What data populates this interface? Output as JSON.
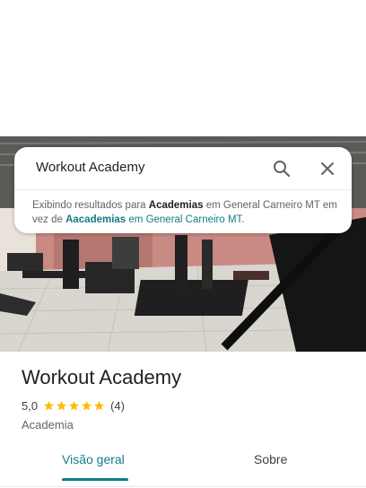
{
  "search": {
    "query": "Workout Academy",
    "notice_prefix": "Exibindo resultados para ",
    "notice_bold": "Academias",
    "notice_location": " em General Carneiro MT",
    "notice_middle": " em vez de ",
    "notice_alt_bold": "Aacademias",
    "notice_alt_location": " em General Carneiro MT",
    "notice_end": "."
  },
  "place": {
    "name": "Workout Academy",
    "rating": "5,0",
    "stars": 5,
    "review_count": "(4)",
    "category": "Academia"
  },
  "tabs": [
    {
      "label": "Visão geral",
      "active": true
    },
    {
      "label": "Sobre",
      "active": false
    }
  ],
  "colors": {
    "accent": "#127c88",
    "star": "#fbbc04",
    "text": "#202124"
  },
  "icons": {
    "search": "search-icon",
    "close": "close-icon",
    "star": "star-icon"
  }
}
